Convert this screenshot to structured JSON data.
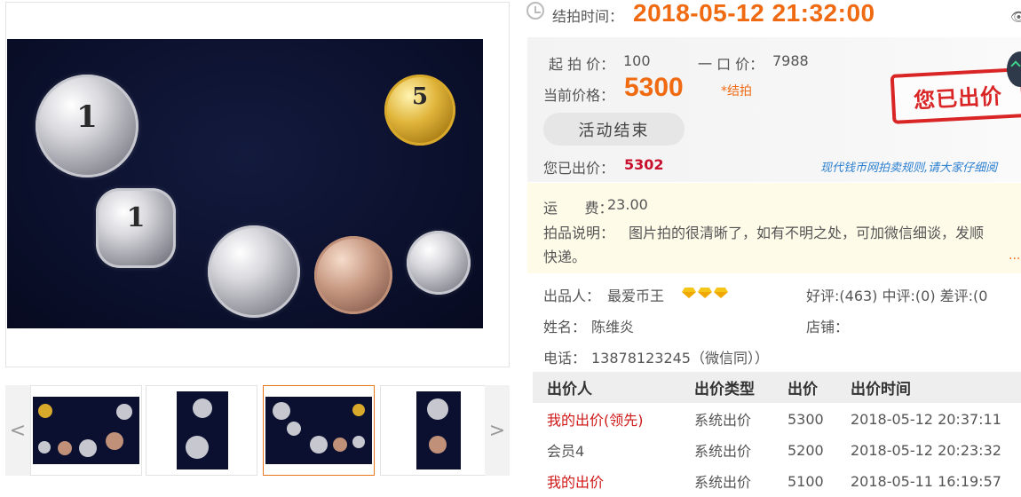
{
  "auction": {
    "end_label": "结拍时间：",
    "end_time": "2018-05-12 21:32:00",
    "start_price_label": "起 拍 价：",
    "start_price": "100",
    "buy_now_label": "一 口 价：",
    "buy_now": "7988",
    "current_price_label": "当前价格：",
    "current_price": "5300",
    "ended_tag": "*结拍",
    "action_button": "活动结束",
    "my_bid_label": "您已出价：",
    "my_bid": "5302",
    "rules_link": "现代钱币网拍卖规则,请大家仔细阅",
    "stamp_text": "您已出价"
  },
  "details": {
    "shipping_label": "运      费：",
    "shipping": "23.00",
    "desc_label": "拍品说明：",
    "desc_line1": "图片拍的很清晰了，如有不明之处，可加微信细谈，发顺",
    "desc_line2": "快递。",
    "more": "..."
  },
  "seller": {
    "seller_label": "出品人：",
    "seller_name": "最爱币王",
    "rating": "好评:(463) 中评:(0) 差评:(0",
    "name_label": "姓名：",
    "name": "陈维炎",
    "shop_label": "店铺：",
    "shop": "",
    "phone_label": "电话：",
    "phone": "13878123245（微信同））"
  },
  "bids": {
    "headers": [
      "出价人",
      "出价类型",
      "出价",
      "出价时间"
    ],
    "rows": [
      {
        "bidder": "我的出价(领先)",
        "type": "系统出价",
        "price": "5300",
        "time": "2018-05-12 20:37:11",
        "mine": true
      },
      {
        "bidder": "会员4",
        "type": "系统出价",
        "price": "5200",
        "time": "2018-05-12 20:23:32",
        "mine": false
      },
      {
        "bidder": "我的出价",
        "type": "系统出价",
        "price": "5100",
        "time": "2018-05-11 16:19:57",
        "mine": true
      }
    ]
  },
  "gallery": {
    "prev": "<",
    "next": ">",
    "coin_main_1": "1",
    "coin_main_5": "5",
    "coin_main_1b": "1"
  },
  "colors": {
    "accent": "#f06a12",
    "bid_red": "#c8102e",
    "link_blue": "#2b7fd0"
  }
}
